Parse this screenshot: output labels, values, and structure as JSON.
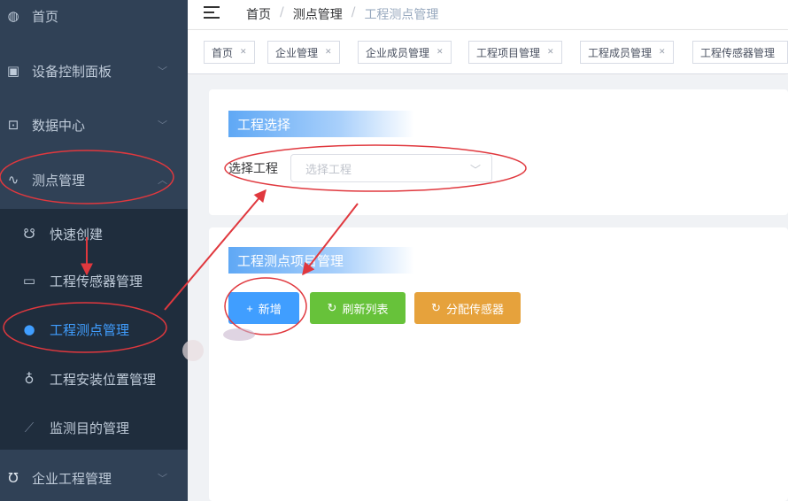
{
  "sidebar": {
    "items": [
      {
        "label": "首页",
        "icon": "dashboard-icon"
      },
      {
        "label": "设备控制面板",
        "icon": "monitor-icon"
      },
      {
        "label": "数据中心",
        "icon": "message-icon"
      },
      {
        "label": "测点管理",
        "icon": "chart-icon"
      }
    ],
    "subitems": [
      {
        "label": "快速创建",
        "icon": "link-icon"
      },
      {
        "label": "工程传感器管理",
        "icon": "device-icon"
      },
      {
        "label": "工程测点管理",
        "icon": "dot-icon"
      },
      {
        "label": "工程安装位置管理",
        "icon": "location-icon"
      },
      {
        "label": "监测目的管理",
        "icon": "line-chart-icon"
      }
    ],
    "bottom_item": {
      "label": "企业工程管理",
      "icon": "shield-icon"
    }
  },
  "navbar": {
    "breadcrumb": [
      "首页",
      "测点管理",
      "工程测点管理"
    ],
    "separator": "/"
  },
  "tags": [
    "首页",
    "企业管理",
    "企业成员管理",
    "工程项目管理",
    "工程成员管理",
    "工程传感器管理"
  ],
  "section1": {
    "title": "工程选择",
    "select_label": "选择工程",
    "select_placeholder": "选择工程"
  },
  "section2": {
    "title": "工程测点项目管理",
    "buttons": {
      "add": "新增",
      "refresh": "刷新列表",
      "assign": "分配传感器"
    }
  },
  "colors": {
    "sidebar_bg": "#304156",
    "submenu_bg": "#1f2d3d",
    "active": "#409eff",
    "primary": "#409eff",
    "success": "#67c23a",
    "warning": "#e6a23c",
    "annotation": "#e0383e"
  }
}
